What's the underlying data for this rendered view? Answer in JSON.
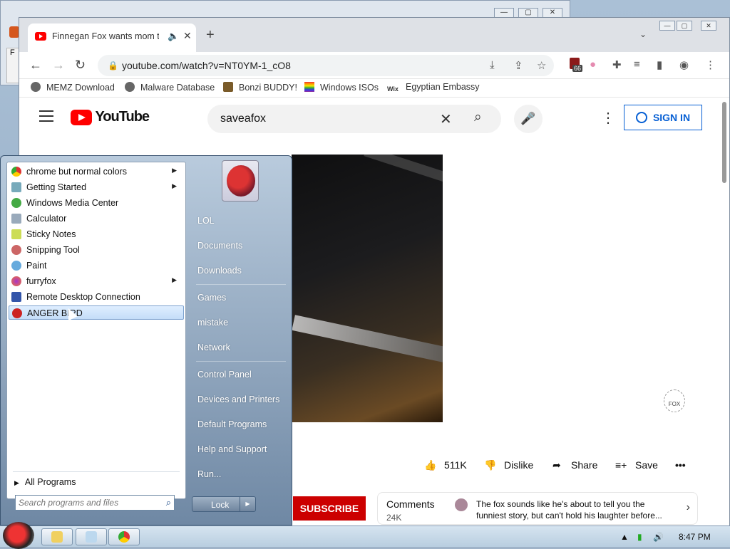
{
  "colors": {
    "youtube_red": "#ff0000",
    "signin_blue": "#065fd4",
    "subscribe_red": "#cc0000",
    "startmenu_highlight": "#c4ddf8"
  },
  "chrome": {
    "tab": {
      "title": "Finnegan Fox wants mom to",
      "favicon": "youtube-icon",
      "audio_icon": "speaker-icon"
    },
    "address": "youtube.com/watch?v=NT0YM-1_cO8",
    "extension_badge": "66",
    "bookmarks": [
      {
        "label": "MEMZ Download",
        "icon": "globe-icon"
      },
      {
        "label": "Malware Database",
        "icon": "globe-icon"
      },
      {
        "label": "Bonzi BUDDY!",
        "icon": "bonzi-icon"
      },
      {
        "label": "Windows ISOs",
        "icon": "rainbow-icon"
      },
      {
        "label": "Egyptian Embassy",
        "icon": "wix-icon"
      }
    ]
  },
  "youtube": {
    "logo_text": "YouTube",
    "search_query": "saveafox",
    "sign_in": "SIGN IN",
    "likes": "511K",
    "dislike": "Dislike",
    "share": "Share",
    "save": "Save",
    "subscribe": "SUBSCRIBE",
    "comments": {
      "heading": "Comments",
      "count": "24K",
      "top_comment": "The fox sounds like he's about to tell you the funniest story, but can't hold his laughter before..."
    }
  },
  "start_menu": {
    "programs": [
      {
        "label": "chrome but normal colors",
        "icon": "chrome-icon",
        "submenu": true,
        "highlighted": false
      },
      {
        "label": "Getting Started",
        "icon": "getting-started-icon",
        "submenu": true,
        "highlighted": false
      },
      {
        "label": "Windows Media Center",
        "icon": "media-center-icon",
        "submenu": false,
        "highlighted": false
      },
      {
        "label": "Calculator",
        "icon": "calculator-icon",
        "submenu": false,
        "highlighted": false
      },
      {
        "label": "Sticky Notes",
        "icon": "sticky-notes-icon",
        "submenu": false,
        "highlighted": false
      },
      {
        "label": "Snipping Tool",
        "icon": "snipping-tool-icon",
        "submenu": false,
        "highlighted": false
      },
      {
        "label": "Paint",
        "icon": "paint-icon",
        "submenu": false,
        "highlighted": false
      },
      {
        "label": "furryfox",
        "icon": "firefox-icon",
        "submenu": true,
        "highlighted": false
      },
      {
        "label": "Remote Desktop Connection",
        "icon": "remote-desktop-icon",
        "submenu": false,
        "highlighted": false
      },
      {
        "label": "ANGER BIRD",
        "icon": "angry-bird-icon",
        "submenu": false,
        "highlighted": true
      }
    ],
    "all_programs": "All Programs",
    "search_placeholder": "Search programs and files",
    "right_items": [
      "LOL",
      "Documents",
      "Downloads",
      "Games",
      "mistake",
      "Network",
      "Control Panel",
      "Devices and Printers",
      "Default Programs",
      "Help and Support",
      "Run..."
    ],
    "lock": "Lock"
  },
  "taskbar": {
    "clock": "8:47 PM",
    "pinned": [
      "explorer-icon",
      "notepad-icon",
      "chrome-icon"
    ]
  }
}
